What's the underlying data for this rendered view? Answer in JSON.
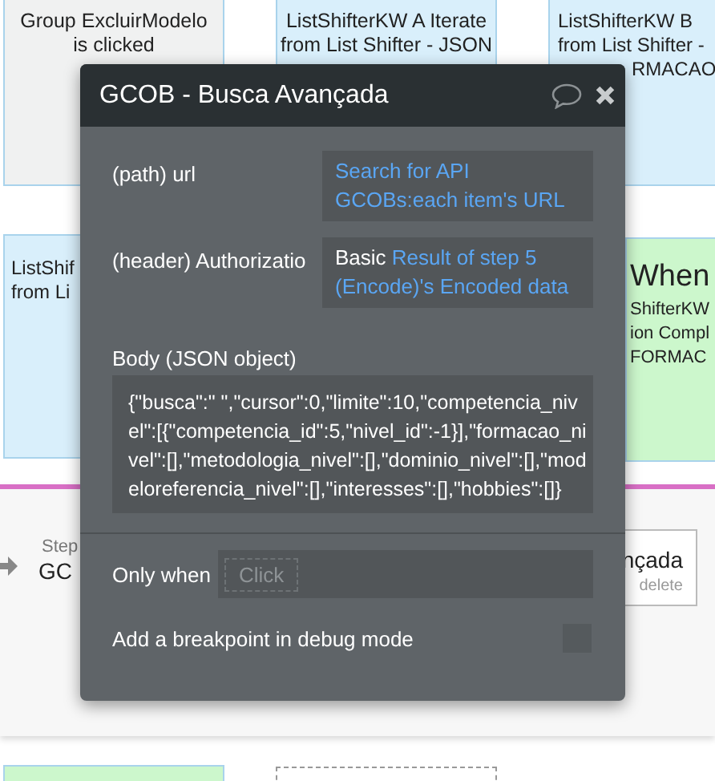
{
  "canvas": {
    "cards": [
      {
        "color": "#f0f1f1",
        "lines": [
          "Group ExcluirModelo",
          "is clicked"
        ]
      },
      {
        "color": "#d9effb",
        "lines": [
          "ListShifterKW A Iterate",
          "from List Shifter - JSON"
        ]
      },
      {
        "color": "#d9effb",
        "lines": [
          "ListShifterKW B",
          "from List Shifter -",
          "RMACAO"
        ]
      },
      {
        "color": "#d9effb",
        "lines": [
          "ListShif",
          "from Li"
        ]
      },
      {
        "color": "#ccf7cc",
        "title": "When",
        "lines": [
          "ShifterKW",
          "ion Compl",
          "FORMAC"
        ]
      },
      {
        "color": "#ccf7cc"
      }
    ],
    "step": {
      "caption": "Step",
      "name": "GC",
      "action_title": "nçada",
      "delete": "delete"
    }
  },
  "dialog": {
    "title": "GCOB - Busca Avançada",
    "fields": [
      {
        "label": "(path) url",
        "segments": [
          {
            "text": "Search for API GCOBs:each item's URL",
            "dynamic": true
          }
        ]
      },
      {
        "label": "(header) Authorizatio",
        "segments": [
          {
            "text": "Basic ",
            "dynamic": false
          },
          {
            "text": "Result of step 5 (Encode)'s Encoded data",
            "dynamic": true
          }
        ]
      }
    ],
    "body": {
      "label": "Body (JSON object)",
      "value": "{\"busca\":\" \",\"cursor\":0,\"limite\":10,\"competencia_nivel\":[{\"competencia_id\":5,\"nivel_id\":-1}],\"formacao_nivel\":[],\"metodologia_nivel\":[],\"dominio_nivel\":[],\"modeloreferencia_nivel\":[],\"interesses\":[],\"hobbies\":[]}"
    },
    "only_when": {
      "label": "Only when",
      "placeholder": "Click"
    },
    "breakpoint": {
      "label": "Add a breakpoint in debug mode",
      "checked": false
    }
  }
}
